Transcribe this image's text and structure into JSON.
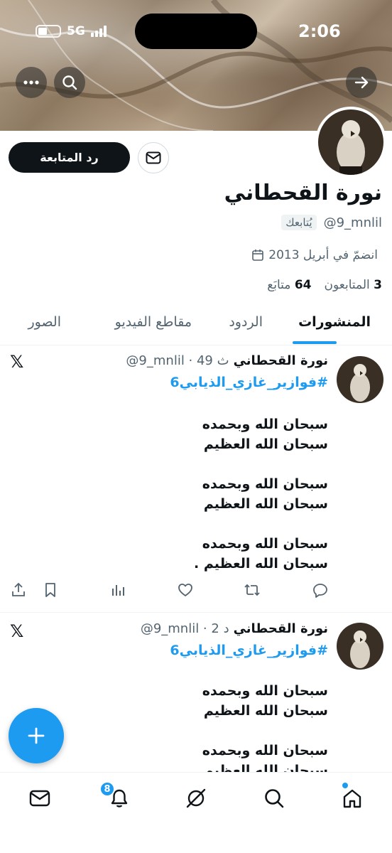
{
  "status_bar": {
    "time": "2:06",
    "network": "5G"
  },
  "profile": {
    "display_name": "نورة القحطاني",
    "handle": "@9_mnlil",
    "follows_you_label": "يُتابعك",
    "joined": "انضمّ في أبريل 2013",
    "following_count": "64",
    "following_label": "متابَع",
    "followers_count": "3",
    "followers_label": "المتابعون",
    "follow_back_label": "رد المتابعة"
  },
  "tabs": [
    {
      "label": "المنشورات",
      "active": true
    },
    {
      "label": "الردود",
      "active": false
    },
    {
      "label": "مقاطع الفيديو",
      "active": false
    },
    {
      "label": "الصور",
      "active": false
    }
  ],
  "posts": [
    {
      "author": "نورة القحطاني",
      "meta": "@9_mnlil · 49 ث",
      "hashtag": "#فوازير_غازي_الذيابي6",
      "lines": [
        "سبحان الله وبحمده",
        "سبحان الله العظيم",
        "",
        "سبحان الله وبحمده",
        "سبحان الله العظيم",
        "",
        "سبحان الله وبحمده",
        "سبحان الله العظيم ."
      ]
    },
    {
      "author": "نورة القحطاني",
      "meta": "@9_mnlil · 2 د",
      "hashtag": "#فوازير_غازي_الذيابي6",
      "lines": [
        "سبحان الله وبحمده",
        "سبحان الله العظيم",
        "",
        "سبحان الله وبحمده",
        "سبحان الله العظيم"
      ]
    }
  ],
  "x_logo": "𝕏",
  "fab_label": "+",
  "notifications_badge": "8",
  "colors": {
    "accent": "#1d9bf0",
    "text": "#0f1419",
    "muted": "#536471"
  },
  "icons": [
    "arrow-right-icon",
    "search-icon",
    "more-icon",
    "mail-icon",
    "calendar-icon",
    "reply-icon",
    "retweet-icon",
    "like-icon",
    "views-icon",
    "bookmark-icon",
    "share-icon",
    "home-icon",
    "grok-icon",
    "bell-icon"
  ]
}
